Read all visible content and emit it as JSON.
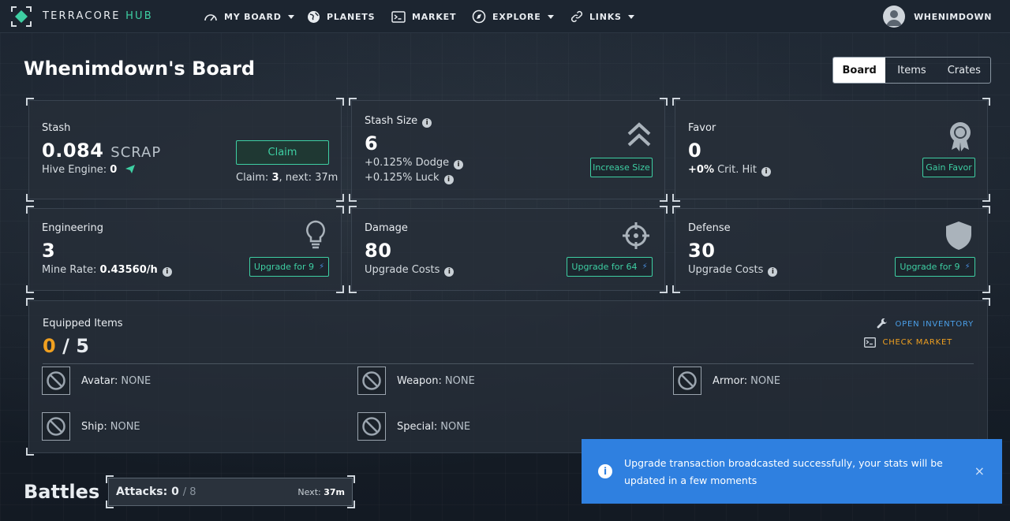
{
  "nav": {
    "brand_main": "TERRACORE",
    "brand_hub": "HUB",
    "items": [
      {
        "label": "MY BOARD",
        "icon": "gauge-icon"
      },
      {
        "label": "PLANETS",
        "icon": "globe-icon"
      },
      {
        "label": "MARKET",
        "icon": "terminal-icon"
      },
      {
        "label": "EXPLORE",
        "icon": "compass-icon"
      },
      {
        "label": "LINKS",
        "icon": "link-icon"
      }
    ],
    "username": "WHENIMDOWN"
  },
  "header": {
    "title": "Whenimdown's Board",
    "tabs": [
      "Board",
      "Items",
      "Crates"
    ],
    "active_tab": "Board"
  },
  "stash": {
    "label": "Stash",
    "amount": "0.084",
    "unit": "SCRAP",
    "hive_label": "Hive Engine:",
    "hive_value": "0",
    "claim_label": "Claim",
    "claim_info_prefix": "Claim:",
    "claim_count": "3",
    "claim_next": ", next: 37m"
  },
  "stash_size": {
    "label": "Stash Size",
    "value": "6",
    "dodge_prefix": "+0.125%",
    "dodge_label": "Dodge",
    "luck_prefix": "+0.125%",
    "luck_label": "Luck",
    "button": "Increase Size"
  },
  "favor": {
    "label": "Favor",
    "value": "0",
    "crit_prefix": "+0%",
    "crit_label": "Crit. Hit",
    "button": "Gain Favor"
  },
  "engineering": {
    "label": "Engineering",
    "value": "3",
    "rate_label": "Mine Rate:",
    "rate_value": "0.43560/h",
    "button": "Upgrade for 9"
  },
  "damage": {
    "label": "Damage",
    "value": "80",
    "sub": "Upgrade Costs",
    "button": "Upgrade for 64"
  },
  "defense": {
    "label": "Defense",
    "value": "30",
    "sub": "Upgrade Costs",
    "button": "Upgrade for 9"
  },
  "equipped": {
    "label": "Equipped Items",
    "current": "0",
    "separator": "/",
    "max": "5",
    "open_inventory": "OPEN INVENTORY",
    "check_market": "CHECK MARKET",
    "slots": [
      {
        "name": "Avatar:",
        "value": "NONE"
      },
      {
        "name": "Weapon:",
        "value": "NONE"
      },
      {
        "name": "Armor:",
        "value": "NONE"
      },
      {
        "name": "Ship:",
        "value": "NONE"
      },
      {
        "name": "Special:",
        "value": "NONE"
      }
    ]
  },
  "battles": {
    "title": "Battles",
    "attacks_label": "Attacks:",
    "attacks_value": "0",
    "attacks_max": "/ 8",
    "next_label": "Next:",
    "next_value": "37m"
  },
  "toast": {
    "message": "Upgrade transaction broadcasted successfully, your stats will be updated in a few moments",
    "close": "×"
  },
  "colors": {
    "accent_green": "#3ecfa3",
    "accent_orange": "#f0a020",
    "toast_blue": "#2f80e0"
  }
}
